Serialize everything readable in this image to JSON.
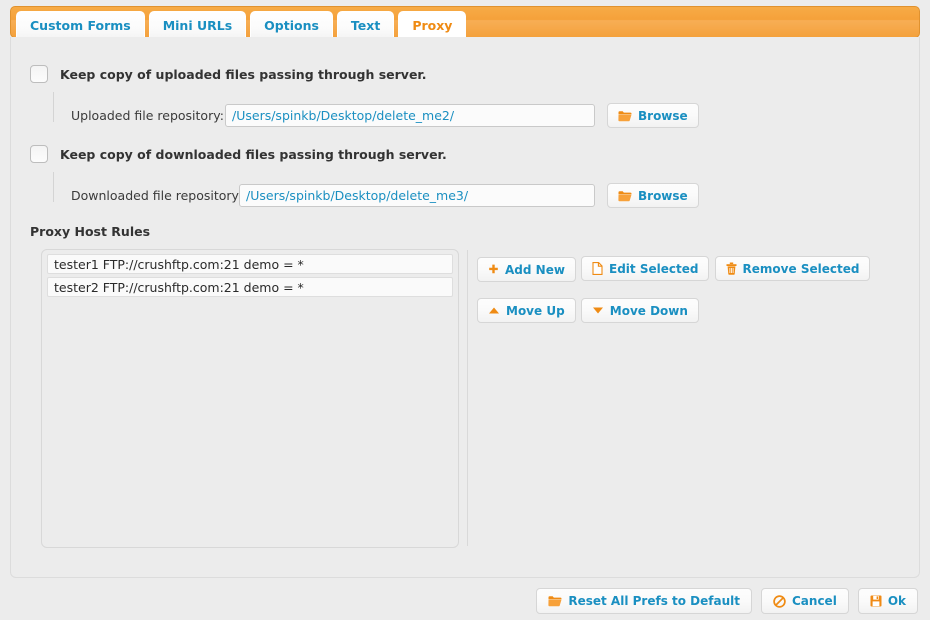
{
  "window": {
    "accent_orange": "#f5a13a",
    "link_blue": "#1a8fc1",
    "bg": "#ececec"
  },
  "tabs": [
    {
      "label": "Custom Forms",
      "active": false
    },
    {
      "label": "Mini URLs",
      "active": false
    },
    {
      "label": "Options",
      "active": false
    },
    {
      "label": "Text",
      "active": false
    },
    {
      "label": "Proxy",
      "active": true
    }
  ],
  "upload": {
    "checkbox_label": "Keep copy of uploaded files passing through server.",
    "checked": false,
    "field_label": "Uploaded file repository:",
    "field_value": "/Users/spinkb/Desktop/delete_me2/",
    "browse_label": "Browse",
    "browse_icon": "folder-open-icon"
  },
  "download": {
    "checkbox_label": "Keep copy of downloaded files passing through server.",
    "checked": false,
    "field_label": "Downloaded file repository:",
    "field_value": "/Users/spinkb/Desktop/delete_me3/",
    "browse_label": "Browse",
    "browse_icon": "folder-open-icon"
  },
  "proxy_rules": {
    "title": "Proxy Host Rules",
    "items": [
      "tester1 FTP://crushftp.com:21 demo = *",
      "tester2 FTP://crushftp.com:21 demo = *"
    ],
    "actions": [
      {
        "label": "Add New",
        "icon": "plus-icon"
      },
      {
        "label": "Edit Selected",
        "icon": "document-icon"
      },
      {
        "label": "Remove Selected",
        "icon": "trash-icon"
      },
      {
        "label": "Move Up",
        "icon": "triangle-up-icon"
      },
      {
        "label": "Move Down",
        "icon": "triangle-down-icon"
      }
    ]
  },
  "footer": {
    "reset_label": "Reset All Prefs to Default",
    "reset_icon": "folder-icon",
    "cancel_label": "Cancel",
    "cancel_icon": "no-entry-icon",
    "ok_label": "Ok",
    "ok_icon": "save-disk-icon"
  }
}
